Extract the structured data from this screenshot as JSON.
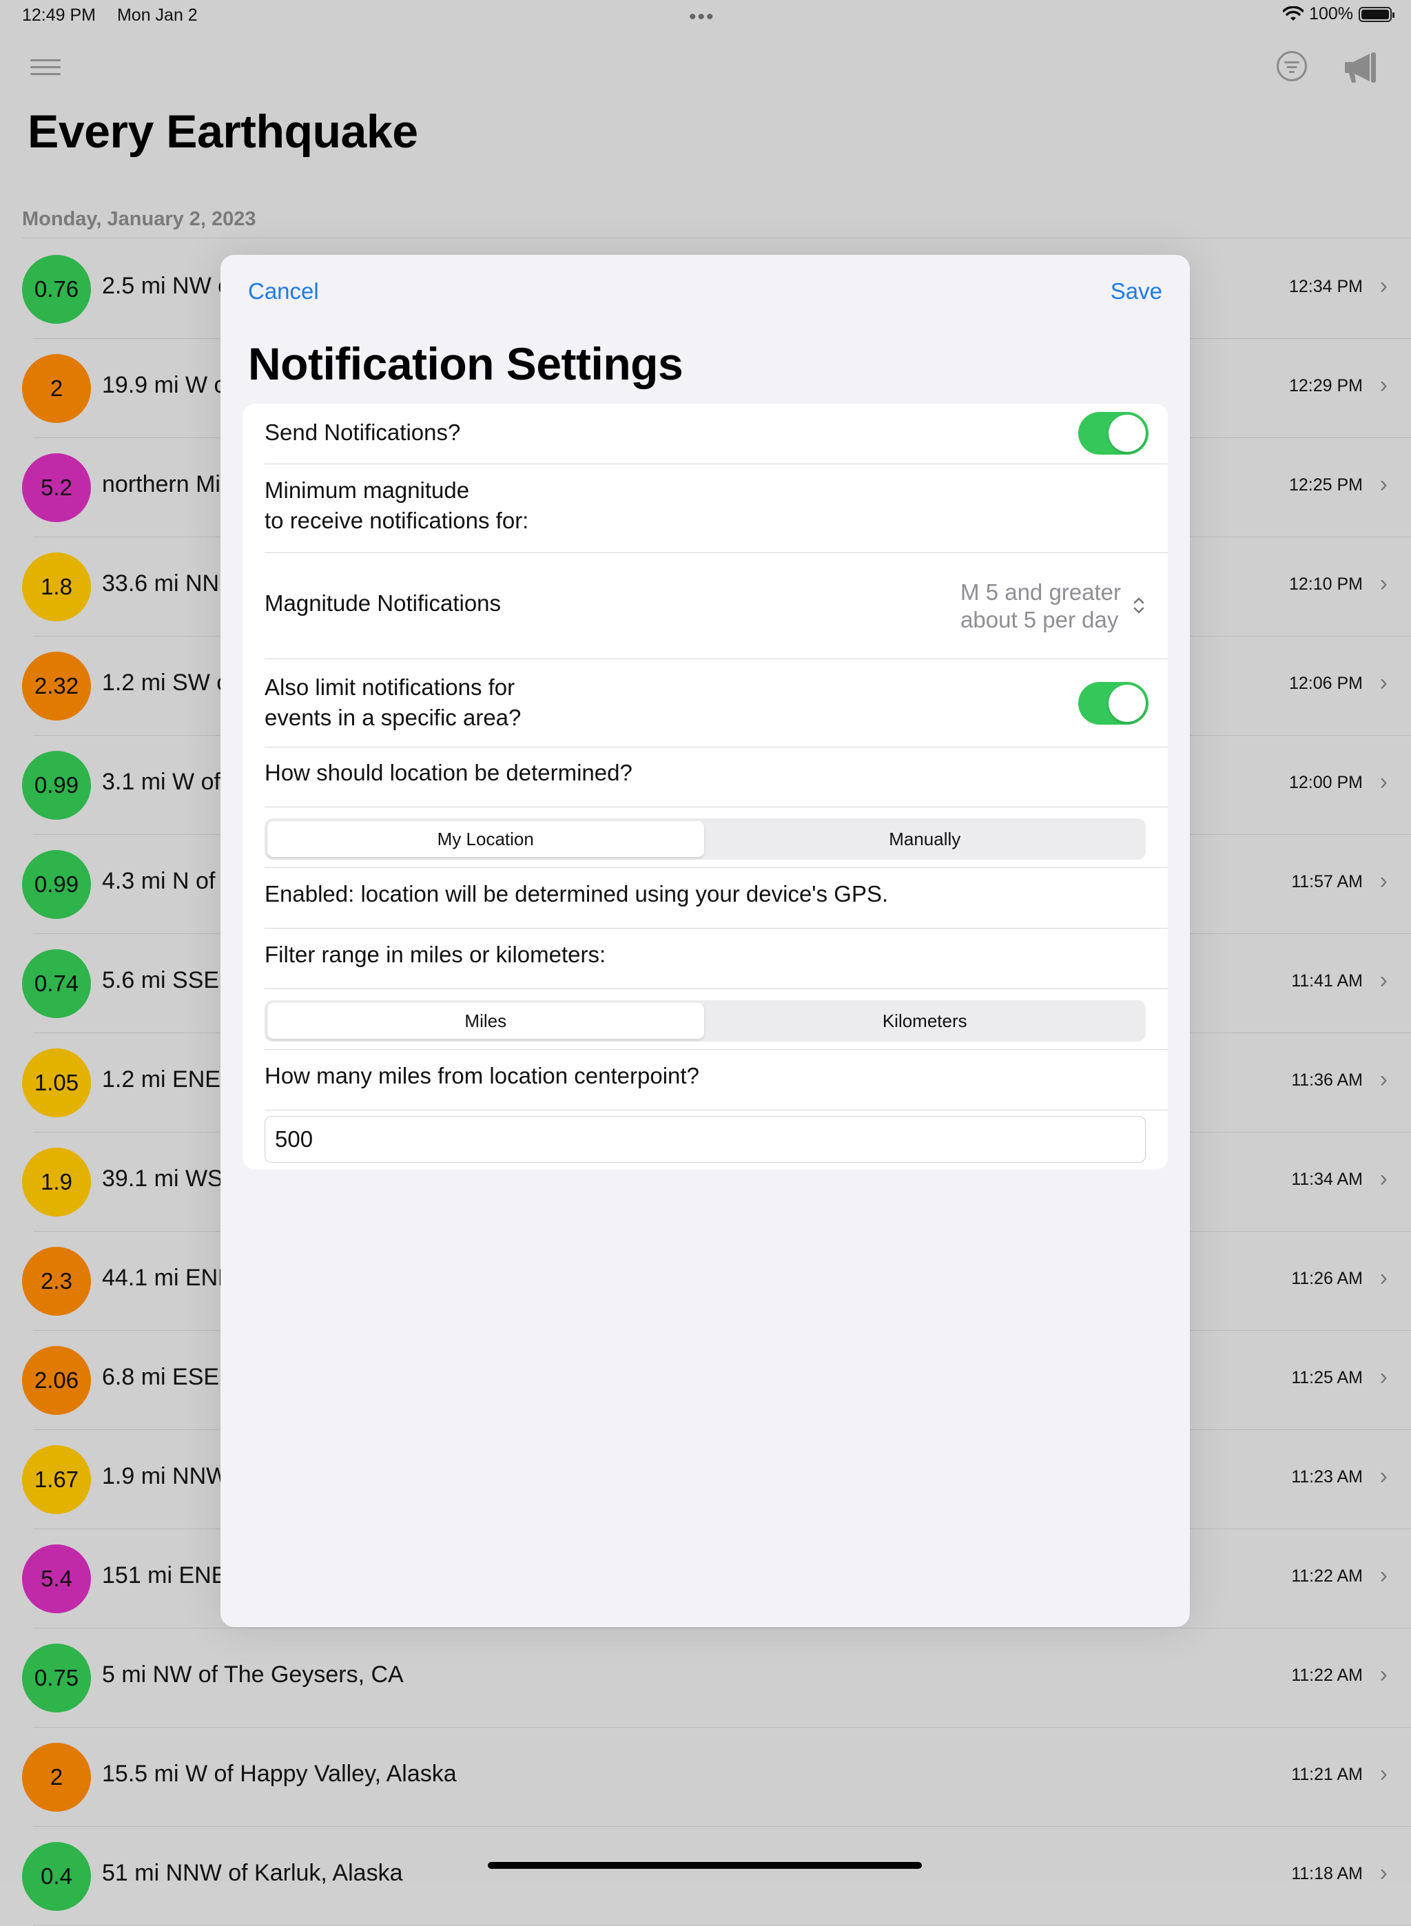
{
  "status": {
    "time": "12:49 PM",
    "date": "Mon Jan 2",
    "battery": "100%"
  },
  "nav": {
    "icons": [
      "hamburger-menu-icon",
      "filter-icon",
      "megaphone-icon"
    ]
  },
  "app_title": "Every Earthquake",
  "section_header": "Monday, January 2, 2023",
  "quakes": [
    {
      "mag": "0.76",
      "place": "2.5 mi NW c",
      "time": "12:34 PM",
      "color": "#2fb34b"
    },
    {
      "mag": "2",
      "place": "19.9 mi W c",
      "time": "12:29 PM",
      "color": "#e07a00"
    },
    {
      "mag": "5.2",
      "place": "northern Mi",
      "time": "12:25 PM",
      "color": "#c02aa9"
    },
    {
      "mag": "1.8",
      "place": "33.6 mi NN",
      "time": "12:10 PM",
      "color": "#e3b100"
    },
    {
      "mag": "2.32",
      "place": "1.2 mi SW c",
      "time": "12:06 PM",
      "color": "#e07a00"
    },
    {
      "mag": "0.99",
      "place": "3.1 mi W of",
      "time": "12:00 PM",
      "color": "#2fb34b"
    },
    {
      "mag": "0.99",
      "place": "4.3 mi N of",
      "time": "11:57 AM",
      "color": "#2fb34b"
    },
    {
      "mag": "0.74",
      "place": "5.6 mi SSE",
      "time": "11:41 AM",
      "color": "#2fb34b"
    },
    {
      "mag": "1.05",
      "place": "1.2 mi ENE c",
      "time": "11:36 AM",
      "color": "#e3b100"
    },
    {
      "mag": "1.9",
      "place": "39.1 mi WS",
      "time": "11:34 AM",
      "color": "#e3b100"
    },
    {
      "mag": "2.3",
      "place": "44.1 mi ENE",
      "time": "11:26 AM",
      "color": "#e07a00"
    },
    {
      "mag": "2.06",
      "place": "6.8 mi ESE",
      "time": "11:25 AM",
      "color": "#e07a00"
    },
    {
      "mag": "1.67",
      "place": "1.9 mi NNW",
      "time": "11:23 AM",
      "color": "#e3b100"
    },
    {
      "mag": "5.4",
      "place": "151 mi ENE",
      "time": "11:22 AM",
      "color": "#c02aa9"
    },
    {
      "mag": "0.75",
      "place": "5 mi NW of The Geysers, CA",
      "time": "11:22 AM",
      "color": "#2fb34b"
    },
    {
      "mag": "2",
      "place": "15.5 mi W of Happy Valley, Alaska",
      "time": "11:21 AM",
      "color": "#e07a00"
    },
    {
      "mag": "0.4",
      "place": "51 mi NNW of Karluk, Alaska",
      "time": "11:18 AM",
      "color": "#2fb34b"
    }
  ],
  "modal": {
    "cancel": "Cancel",
    "save": "Save",
    "title": "Notification Settings",
    "send_notifications": {
      "label": "Send Notifications?",
      "on": true
    },
    "min_mag_line1": "Minimum magnitude",
    "min_mag_line2": "to receive notifications for:",
    "mag_picker": {
      "label": "Magnitude Notifications",
      "value_line1": "M 5 and greater",
      "value_line2": "about 5 per day"
    },
    "limit_area": {
      "line1": "Also limit notifications for",
      "line2": "events in a specific area?",
      "on": true
    },
    "location_question": "How should location be determined?",
    "location_segment": {
      "options": [
        "My Location",
        "Manually"
      ],
      "selected": "My Location"
    },
    "location_note": "Enabled: location will be determined using your device's GPS.",
    "range_label": "Filter range in miles or kilometers:",
    "unit_segment": {
      "options": [
        "Miles",
        "Kilometers"
      ],
      "selected": "Miles"
    },
    "distance_question": "How many miles from location centerpoint?",
    "distance_value": "500"
  },
  "colors": {
    "accent": "#1e7be6",
    "toggle_on": "#35c759"
  }
}
